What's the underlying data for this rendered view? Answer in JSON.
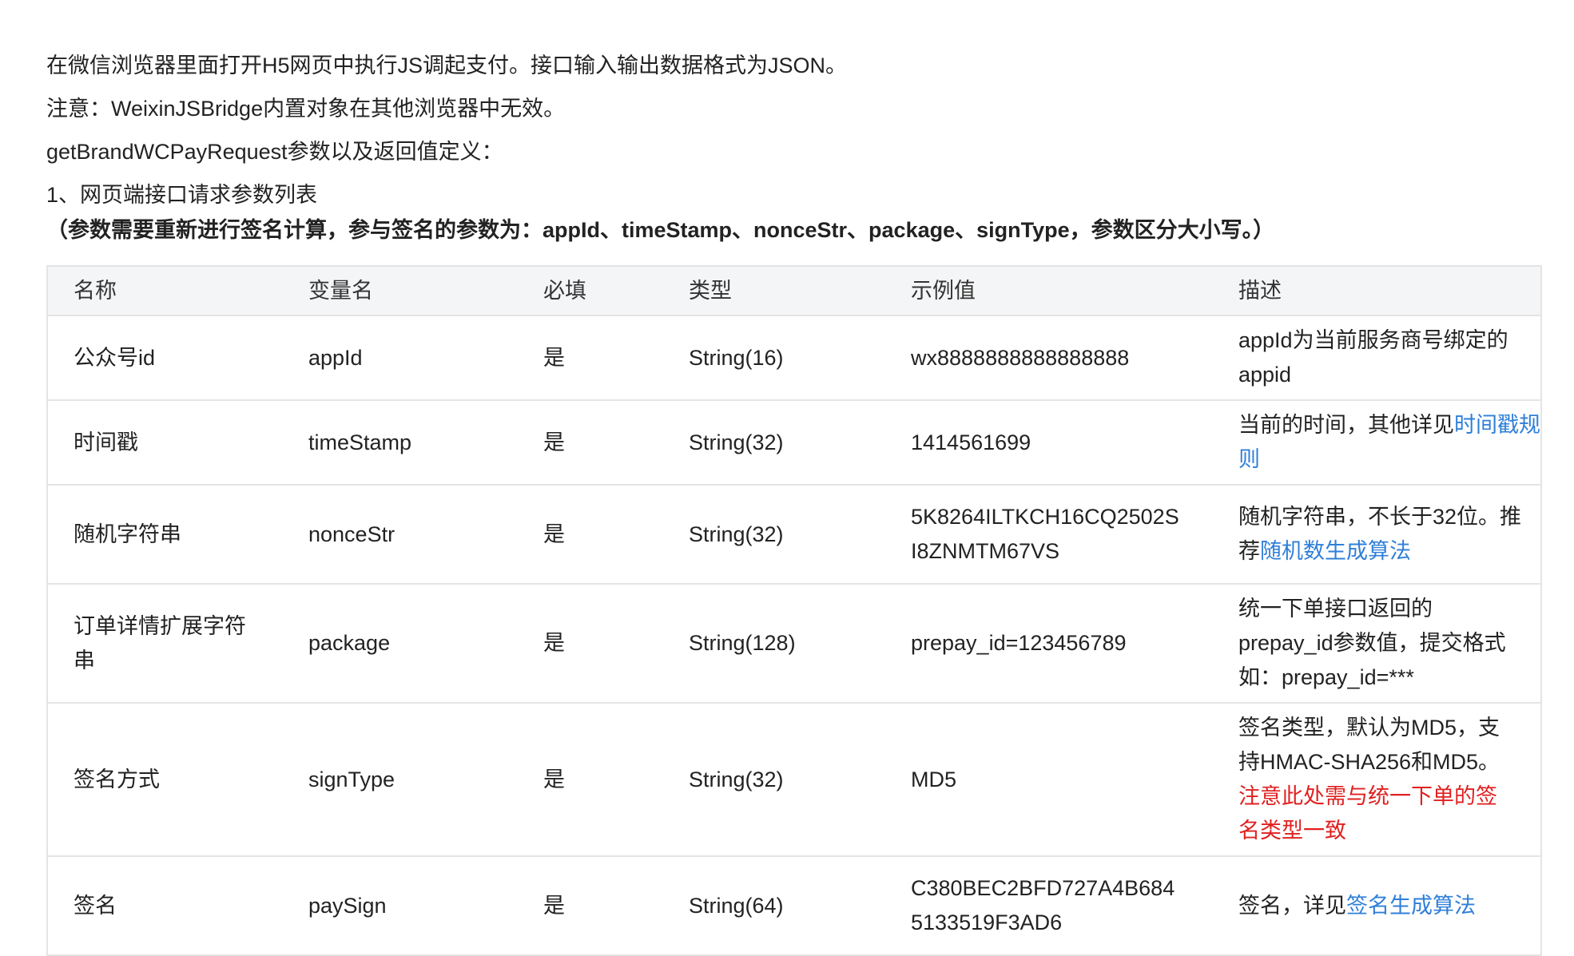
{
  "intro": {
    "line1": "在微信浏览器里面打开H5网页中执行JS调起支付。接口输入输出数据格式为JSON。",
    "line2": "注意：WeixinJSBridge内置对象在其他浏览器中无效。",
    "line3": "getBrandWCPayRequest参数以及返回值定义：",
    "line4_prefix": "1、网页端接口请求参数列表",
    "line4_bold": "（参数需要重新进行签名计算，参与签名的参数为：appId、timeStamp、nonceStr、package、signType，参数区分大小写。）"
  },
  "table": {
    "headers": [
      "名称",
      "变量名",
      "必填",
      "类型",
      "示例值",
      "描述"
    ],
    "rows": [
      {
        "name": "公众号id",
        "var": "appId",
        "required": "是",
        "type": "String(16)",
        "example": "wx8888888888888888",
        "desc": "appId为当前服务商号绑定的appid",
        "desc_link": "",
        "desc_red": ""
      },
      {
        "name": "时间戳",
        "var": "timeStamp",
        "required": "是",
        "type": "String(32)",
        "example": "1414561699",
        "desc": "当前的时间，其他详见",
        "desc_link": "时间戳规则",
        "desc_red": ""
      },
      {
        "name": "随机字符串",
        "var": "nonceStr",
        "required": "是",
        "type": "String(32)",
        "example": "5K8264ILTKCH16CQ2502SI8ZNMTM67VS",
        "desc": "随机字符串，不长于32位。推荐",
        "desc_link": "随机数生成算法",
        "desc_red": ""
      },
      {
        "name": "订单详情扩展字符串",
        "var": "package",
        "required": "是",
        "type": "String(128)",
        "example": "prepay_id=123456789",
        "desc": "统一下单接口返回的prepay_id参数值，提交格式如：prepay_id=***",
        "desc_link": "",
        "desc_red": ""
      },
      {
        "name": "签名方式",
        "var": "signType",
        "required": "是",
        "type": "String(32)",
        "example": "MD5",
        "desc": "签名类型，默认为MD5，支持HMAC-SHA256和MD5。",
        "desc_link": "",
        "desc_red": "注意此处需与统一下单的签名类型一致"
      },
      {
        "name": "签名",
        "var": "paySign",
        "required": "是",
        "type": "String(64)",
        "example": "C380BEC2BFD727A4B6845133519F3AD6",
        "desc": "签名，详见",
        "desc_link": "签名生成算法",
        "desc_red": ""
      }
    ]
  },
  "colors": {
    "link": "#2f7fd8",
    "warning": "#e02020",
    "header_bg": "#f4f5f7",
    "border": "#e4e4e4"
  }
}
